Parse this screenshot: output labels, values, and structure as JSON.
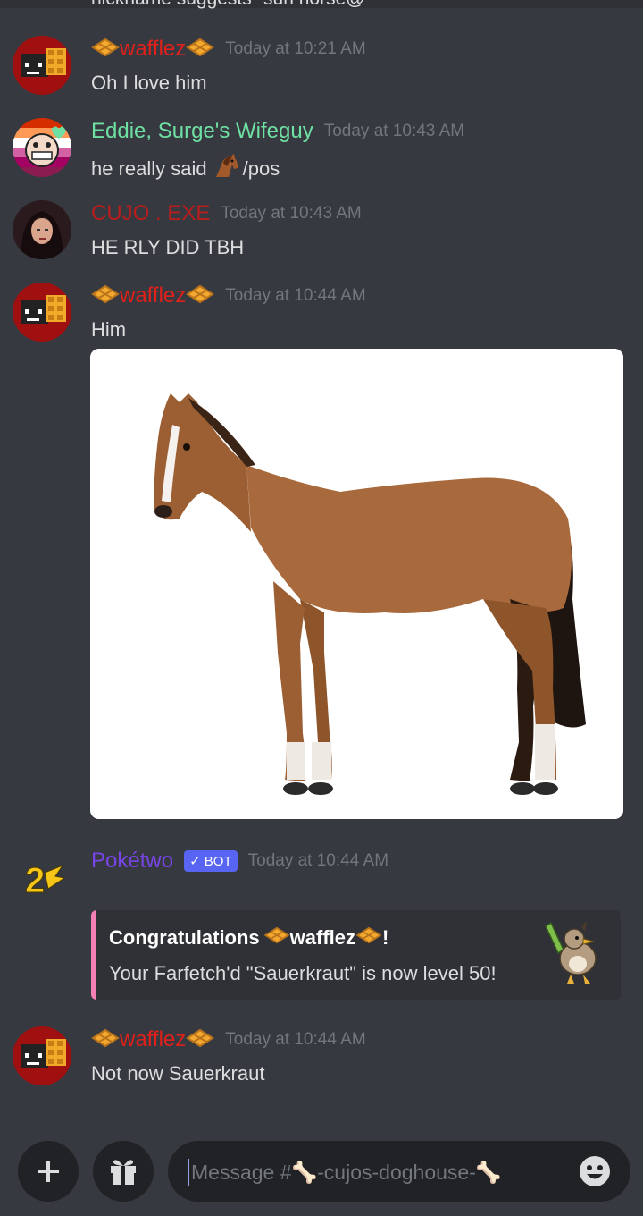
{
  "top_cut_text": "nickname suggests \"sun horse@",
  "messages": [
    {
      "user": "wafflez",
      "time": "Today at 10:21 AM",
      "text": "Oh I love him"
    },
    {
      "user": "Eddie, Surge's Wifeguy",
      "time": "Today at 10:43 AM",
      "text_before": "he really said",
      "text_after": "/pos"
    },
    {
      "user": "CUJO . EXE",
      "time": "Today at 10:43 AM",
      "text": "HE RLY DID TBH"
    },
    {
      "user": "wafflez",
      "time": "Today at 10:44 AM",
      "text": "Him"
    },
    {
      "user": "Pokétwo",
      "badge": "✓ BOT",
      "time": "Today at 10:44 AM",
      "embed": {
        "title_prefix": "Congratulations",
        "title_name": "wafflez",
        "title_suffix": "!",
        "description": "Your Farfetch'd \"Sauerkraut\" is now level 50!"
      }
    },
    {
      "user": "wafflez",
      "time": "Today at 10:44 AM",
      "text": "Not now Sauerkraut"
    }
  ],
  "composer": {
    "placeholder": "Message #🦴-cujos-doghouse-🦴"
  },
  "colors": {
    "background": "#36393f",
    "wafflez": "#e0201b",
    "eddie": "#6ee0a3",
    "cujo": "#b81d1d",
    "poketwo": "#7745e6",
    "bot_badge": "#5865f2",
    "embed_border": "#f47fb4"
  },
  "icons": [
    "plus-icon",
    "gift-icon",
    "emoji-icon",
    "waffle-icon",
    "horse-emoji-icon",
    "bone-icon",
    "pikachu-2-icon",
    "farfetchd-thumbnail"
  ]
}
